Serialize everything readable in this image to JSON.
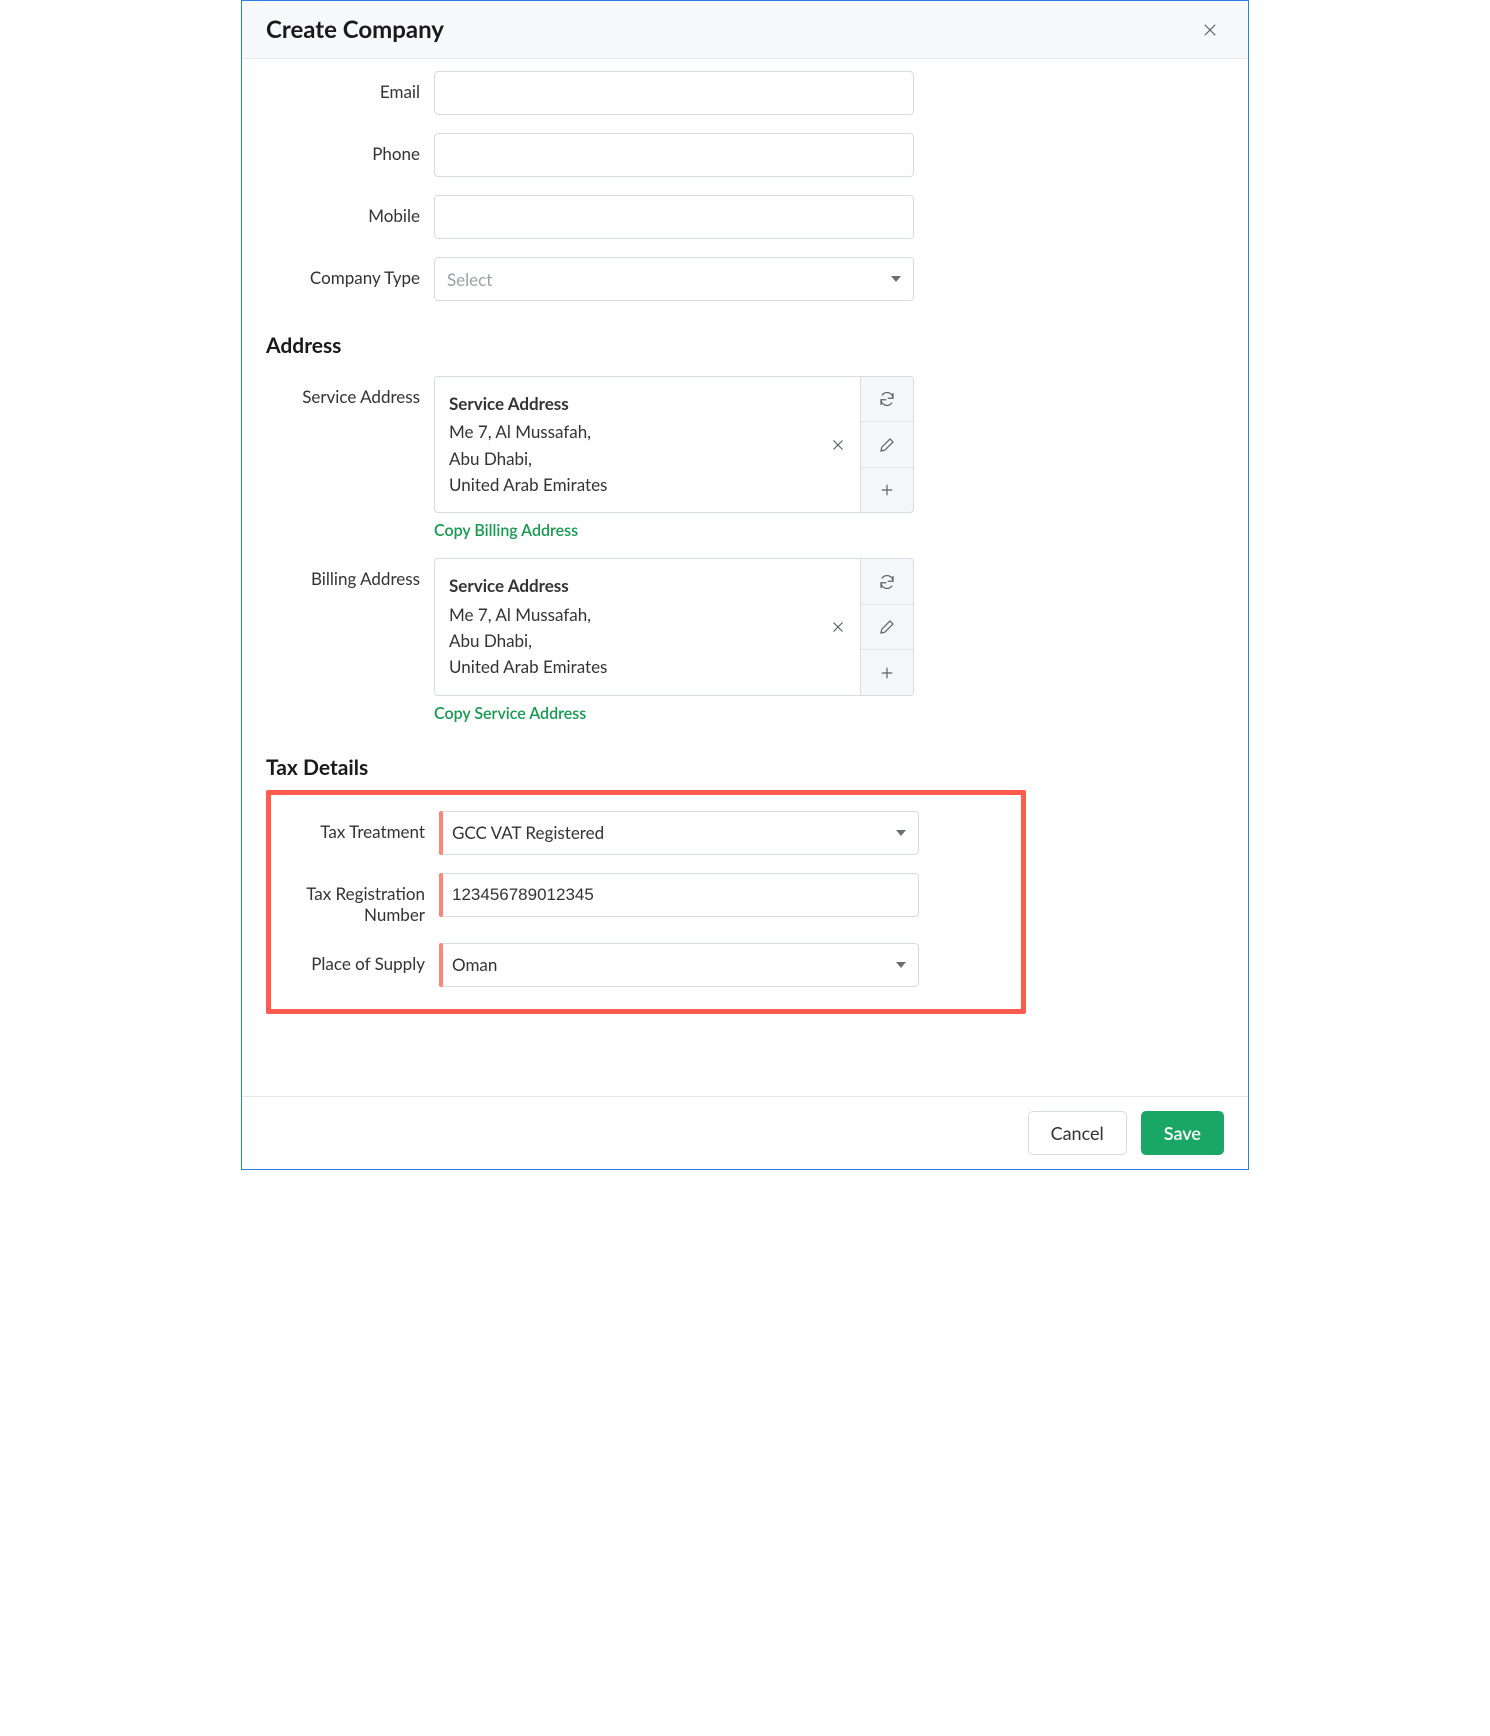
{
  "window": {
    "title": "Create Company"
  },
  "fields": {
    "email": {
      "label": "Email",
      "value": ""
    },
    "phone": {
      "label": "Phone",
      "value": ""
    },
    "mobile": {
      "label": "Mobile",
      "value": ""
    },
    "company_type": {
      "label": "Company Type",
      "placeholder": "Select",
      "value": ""
    }
  },
  "address_section": {
    "heading": "Address",
    "service": {
      "label": "Service Address",
      "card_title": "Service Address",
      "line1": "Me 7, Al Mussafah,",
      "line2": "Abu Dhabi,",
      "line3": "United Arab Emirates",
      "copy_link": "Copy Billing Address"
    },
    "billing": {
      "label": "Billing Address",
      "card_title": "Service Address",
      "line1": "Me 7, Al Mussafah,",
      "line2": "Abu Dhabi,",
      "line3": "United Arab Emirates",
      "copy_link": "Copy Service Address"
    }
  },
  "tax_section": {
    "heading": "Tax Details",
    "treatment": {
      "label": "Tax Treatment",
      "value": "GCC VAT Registered"
    },
    "trn": {
      "label": "Tax Registration Number",
      "value": "123456789012345"
    },
    "place_of_supply": {
      "label": "Place of Supply",
      "value": "Oman"
    }
  },
  "footer": {
    "cancel": "Cancel",
    "save": "Save"
  }
}
